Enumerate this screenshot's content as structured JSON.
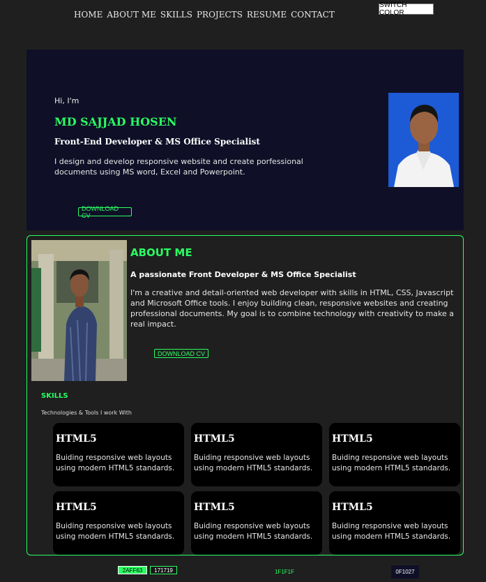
{
  "nav": {
    "items": [
      {
        "label": "HOME"
      },
      {
        "label": "ABOUT ME"
      },
      {
        "label": "SKILLS"
      },
      {
        "label": "PROJECTS"
      },
      {
        "label": "RESUME"
      },
      {
        "label": "CONTACT"
      }
    ],
    "switch_label": "SWITCH COLOR"
  },
  "hero": {
    "greeting": "Hi, I'm",
    "name": "MD SAJJAD HOSEN",
    "role": "Front-End Developer & MS Office Specialist",
    "description": "I design and develop responsive website and create porfessional documents using MS word, Excel and Powerpoint.",
    "cv_button": "DOWNLOAD CV"
  },
  "about": {
    "title": "ABOUT ME",
    "subtitle": "A passionate Front Developer & MS Office Specialist",
    "paragraph": "I'm a creative and detail-oriented web developer with skills in HTML, CSS, Javascript and Microsoft Office tools. I enjoy building clean, responsive websites and creating professional documents. My goal is to combine technology with creativity to make a real impact.",
    "cv_button": "DOWNLOAD CV"
  },
  "skills": {
    "title": "SKILLS",
    "subtitle": "Technologies & Tools I work With",
    "cards": [
      {
        "title": "HTML5",
        "desc": "Buiding responsive web layouts using modern HTML5 standards."
      },
      {
        "title": "HTML5",
        "desc": "Buiding responsive web layouts using modern HTML5 standards."
      },
      {
        "title": "HTML5",
        "desc": "Buiding responsive web layouts using modern HTML5 standards."
      },
      {
        "title": "HTML5",
        "desc": "Buiding responsive web layouts using modern HTML5 standards."
      },
      {
        "title": "HTML5",
        "desc": "Buiding responsive web layouts using modern HTML5 standards."
      },
      {
        "title": "HTML5",
        "desc": "Buiding responsive web layouts using modern HTML5 standards."
      }
    ]
  },
  "swatches": [
    "2AFF63",
    "171719",
    "1F1F1F",
    "0F1027"
  ],
  "colors": {
    "accent": "#2aff63",
    "background": "#1f1f1f",
    "hero_bg": "#0f1027",
    "card_bg": "#000000",
    "photo_bg": "#1d5bd6"
  }
}
